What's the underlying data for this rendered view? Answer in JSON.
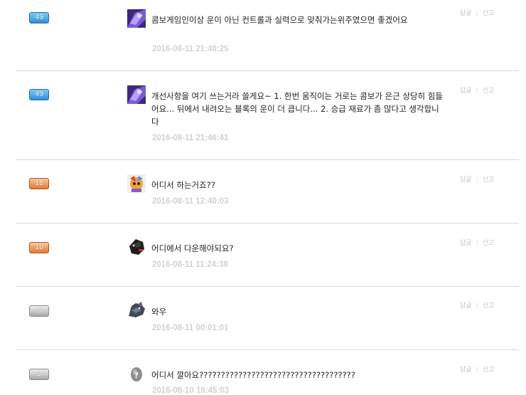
{
  "actions": {
    "reply_label": "답글",
    "report_label": "신고",
    "separator": "|"
  },
  "comments": [
    {
      "level": "49",
      "level_color": "blue",
      "avatar_icon": "purple-character-avatar",
      "text": "콤보게임인이상 운이 아닌 컨트롤과 실력으로 맞춰가는위주였으면 좋겠어요",
      "time": "2016-08-11 21:48:25"
    },
    {
      "level": "49",
      "level_color": "blue",
      "avatar_icon": "purple-character-avatar",
      "text": "개선사항을 여기 쓰는거라 쓸게요~ 1. 한번 움직이는 거로는 콤보가 은근 상당히 힘들어요... 뒤에서 내려오는 블록의 운이 더 큽니다... 2. 승급 재료가 좀 많다고 생각합니다",
      "time": "2016-08-11 21:46:41"
    },
    {
      "level": "18",
      "level_color": "orange",
      "avatar_icon": "colorful-character-avatar",
      "text": "어디서 하는거죠??",
      "time": "2016-08-11 12:40:03"
    },
    {
      "level": "10",
      "level_color": "orange",
      "avatar_icon": "dark-character-avatar",
      "text": "어디에서 다운해야되요?",
      "time": "2016-08-11 11:24:38"
    },
    {
      "level": "5",
      "level_color": "gray",
      "avatar_icon": "wolf-character-avatar",
      "text": "와우",
      "time": "2016-08-11 00:01:01"
    },
    {
      "level": "3",
      "level_color": "gray",
      "avatar_icon": "default-egg-avatar",
      "text": "어디서 깔아요????????????????????????????????????",
      "time": "2016-08-10 18:45:03"
    }
  ],
  "colors": {
    "divider": "#d9d9d9",
    "time_text": "#d2d2d2",
    "level_blue": "#2f8fd6",
    "level_orange": "#e07a36",
    "level_gray": "#a8a8a8"
  }
}
